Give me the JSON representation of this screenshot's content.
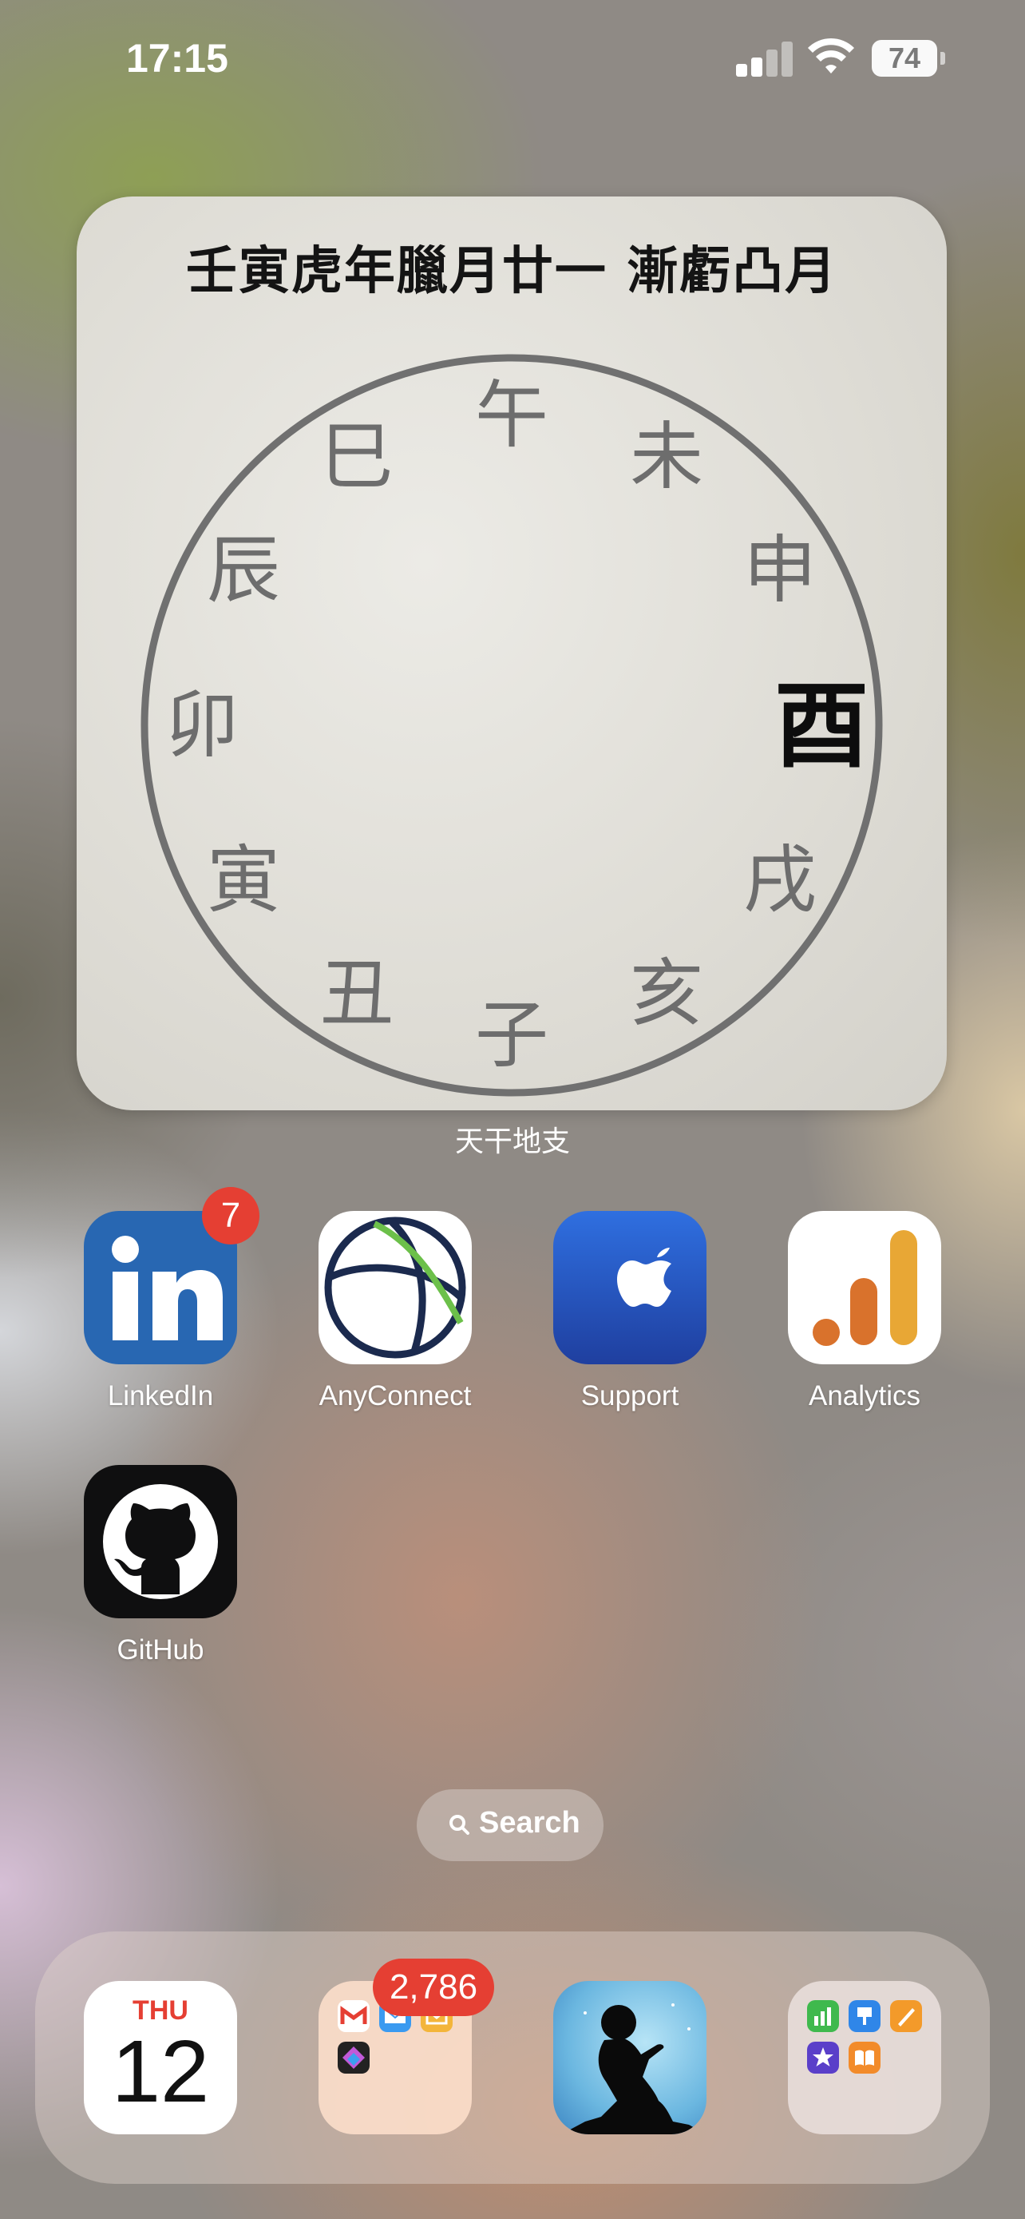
{
  "status_bar": {
    "time": "17:15",
    "battery_level": "74",
    "icons": [
      "cellular-signal-icon",
      "wifi-icon",
      "battery-icon"
    ]
  },
  "widget": {
    "title": "壬寅虎年臘月廿一 漸虧凸月",
    "branches": [
      "午",
      "未",
      "申",
      "酉",
      "戌",
      "亥",
      "子",
      "丑",
      "寅",
      "卯",
      "辰",
      "巳"
    ],
    "highlighted_branch": "酉",
    "label": "天干地支"
  },
  "apps": [
    {
      "name": "LinkedIn",
      "badge": "7"
    },
    {
      "name": "AnyConnect"
    },
    {
      "name": "Support"
    },
    {
      "name": "Analytics"
    },
    {
      "name": "GitHub"
    }
  ],
  "search": {
    "label": "Search"
  },
  "dock": {
    "calendar": {
      "weekday": "THU",
      "day": "12"
    },
    "mail_folder": {
      "badge": "2,786"
    },
    "kindle": {},
    "productivity_folder": {}
  },
  "colors": {
    "badge": "#e53f33",
    "linkedin": "#2867b2",
    "support": "#2458c9",
    "analytics_orange": "#e8a735",
    "analytics_dark": "#d9722c"
  }
}
